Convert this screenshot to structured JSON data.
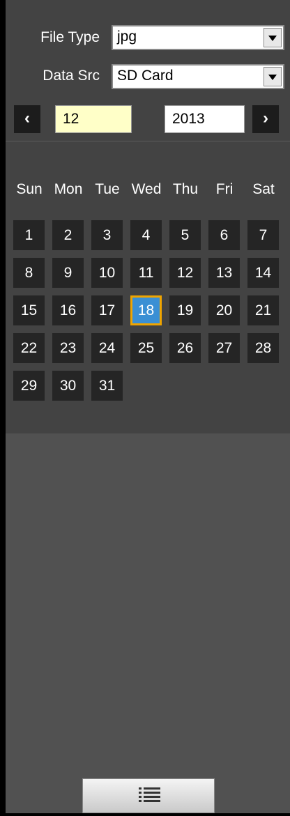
{
  "filters": {
    "file_type_label": "File Type",
    "file_type_value": "jpg",
    "data_src_label": "Data Src",
    "data_src_value": "SD Card"
  },
  "nav": {
    "prev_label": "‹",
    "next_label": "›",
    "month": "12",
    "year": "2013"
  },
  "weekdays": [
    "Sun",
    "Mon",
    "Tue",
    "Wed",
    "Thu",
    "Fri",
    "Sat"
  ],
  "days": [
    "1",
    "2",
    "3",
    "4",
    "5",
    "6",
    "7",
    "8",
    "9",
    "10",
    "11",
    "12",
    "13",
    "14",
    "15",
    "16",
    "17",
    "18",
    "19",
    "20",
    "21",
    "22",
    "23",
    "24",
    "25",
    "26",
    "27",
    "28",
    "29",
    "30",
    "31"
  ],
  "selected_day": "18",
  "footer": {
    "list_icon": "list-icon"
  },
  "colors": {
    "selected_fill": "#3a8fd4",
    "selected_border": "#f0a500",
    "month_field_bg": "#ffffc8"
  }
}
